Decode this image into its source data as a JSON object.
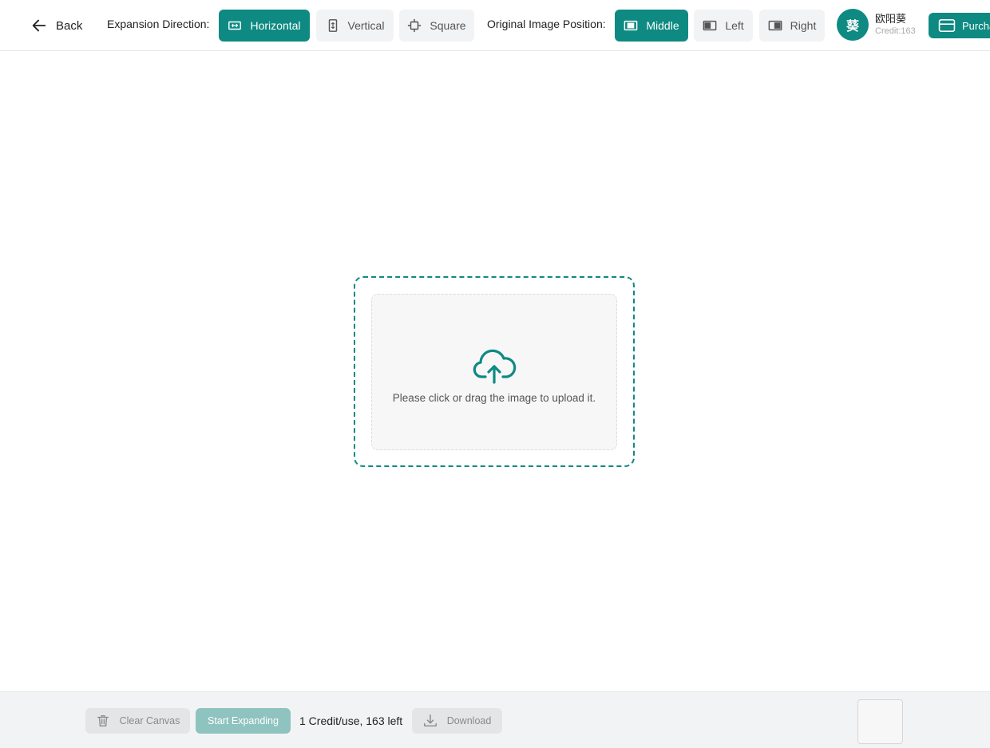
{
  "header": {
    "back_label": "Back",
    "expansion_label": "Expansion Direction:",
    "expansion_options": [
      {
        "label": "Horizontal",
        "icon": "horizontal-expand-icon",
        "selected": true
      },
      {
        "label": "Vertical",
        "icon": "vertical-expand-icon",
        "selected": false
      },
      {
        "label": "Square",
        "icon": "square-expand-icon",
        "selected": false
      }
    ],
    "position_label": "Original Image Position:",
    "position_options": [
      {
        "label": "Middle",
        "icon": "position-middle-icon",
        "selected": true
      },
      {
        "label": "Left",
        "icon": "position-left-icon",
        "selected": false
      },
      {
        "label": "Right",
        "icon": "position-right-icon",
        "selected": false
      }
    ]
  },
  "user": {
    "avatar_char": "葵",
    "name": "欧阳葵",
    "credit": "Credit:163",
    "purchase_label": "Purchase"
  },
  "upload": {
    "icon": "cloud-upload-icon",
    "text": "Please click or drag the image to upload it."
  },
  "footer": {
    "clear_label": "Clear Canvas",
    "start_label": "Start Expanding",
    "usage_text": "1 Credit/use, 163 left",
    "download_label": "Download"
  },
  "colors": {
    "accent": "#0e8a82",
    "accent_disabled": "#8fc3bf",
    "option_bg": "#f2f3f5"
  }
}
